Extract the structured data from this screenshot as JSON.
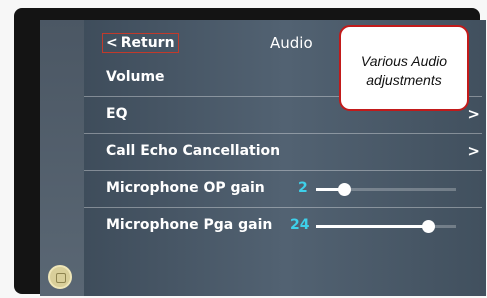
{
  "header": {
    "back_label": "Return",
    "title": "Audio"
  },
  "rows": [
    {
      "label": "Volume"
    },
    {
      "label": "EQ"
    },
    {
      "label": "Call Echo Cancellation"
    },
    {
      "label": "Microphone OP gain",
      "value": "2",
      "level": 0.2
    },
    {
      "label": "Microphone Pga gain",
      "value": "24",
      "level": 0.8
    }
  ],
  "annotation": {
    "line1": "Various Audio",
    "line2": "adjustments"
  },
  "colors": {
    "accent": "#3ed0ea",
    "callout_border": "#c21a1a",
    "back_border": "#c23a2b"
  },
  "icons": [
    "chevron-left-icon",
    "chevron-right-icon",
    "home-icon"
  ]
}
